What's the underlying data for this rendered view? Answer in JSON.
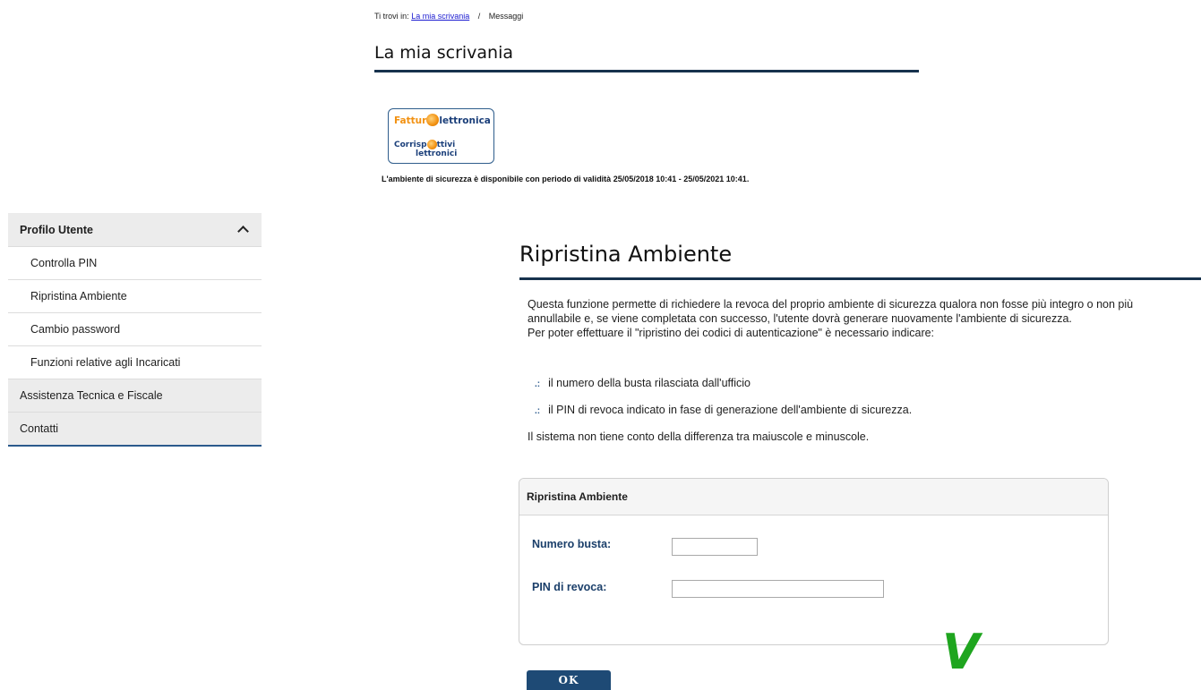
{
  "breadcrumb": {
    "prefix": "Ti trovi in:",
    "link": "La mia scrivania",
    "separator": "/",
    "current": "Messaggi"
  },
  "header": {
    "title": "La mia scrivania",
    "logo_line1_a": "Fattur",
    "logo_line1_b": "lettronica",
    "logo_line2_a": "Corrisp",
    "logo_line2_b": "ttivi",
    "logo_line2_c": "lettronici",
    "validity": "L'ambiente di sicurezza è disponibile con periodo di validità 25/05/2018 10:41 - 25/05/2021 10:41."
  },
  "sidebar": {
    "section": "Profilo Utente",
    "items": [
      {
        "label": "Controlla PIN"
      },
      {
        "label": "Ripristina Ambiente"
      },
      {
        "label": "Cambio password"
      },
      {
        "label": "Funzioni relative agli Incaricati"
      }
    ],
    "top_items": [
      {
        "label": "Assistenza Tecnica e Fiscale"
      },
      {
        "label": "Contatti"
      }
    ]
  },
  "main": {
    "title": "Ripristina Ambiente",
    "intro_1": "Questa funzione permette di richiedere la revoca del proprio ambiente di sicurezza qualora non fosse più integro o non più",
    "intro_2": "annullabile e, se viene completata con successo, l'utente dovrà generare nuovamente l'ambiente di sicurezza.",
    "intro_3": "Per poter effettuare il \"ripristino dei codici di autenticazione\" è necessario indicare:",
    "bullets": [
      "il numero della busta rilasciata dall'ufficio",
      "il PIN di revoca indicato in fase di generazione dell'ambiente di sicurezza."
    ],
    "note": "Il sistema non tiene conto della differenza tra maiuscole e minuscole."
  },
  "form": {
    "title": "Ripristina Ambiente",
    "numero_busta_label": "Numero busta:",
    "numero_busta_value": "",
    "pin_label": "PIN di revoca:",
    "pin_value": "",
    "ok_label": "OK"
  },
  "overlay": {
    "mark": "V",
    "color": "#1fa51f"
  },
  "colors": {
    "rule": "#17324d",
    "accent": "#1e4a75",
    "label": "#1b3f6a"
  }
}
